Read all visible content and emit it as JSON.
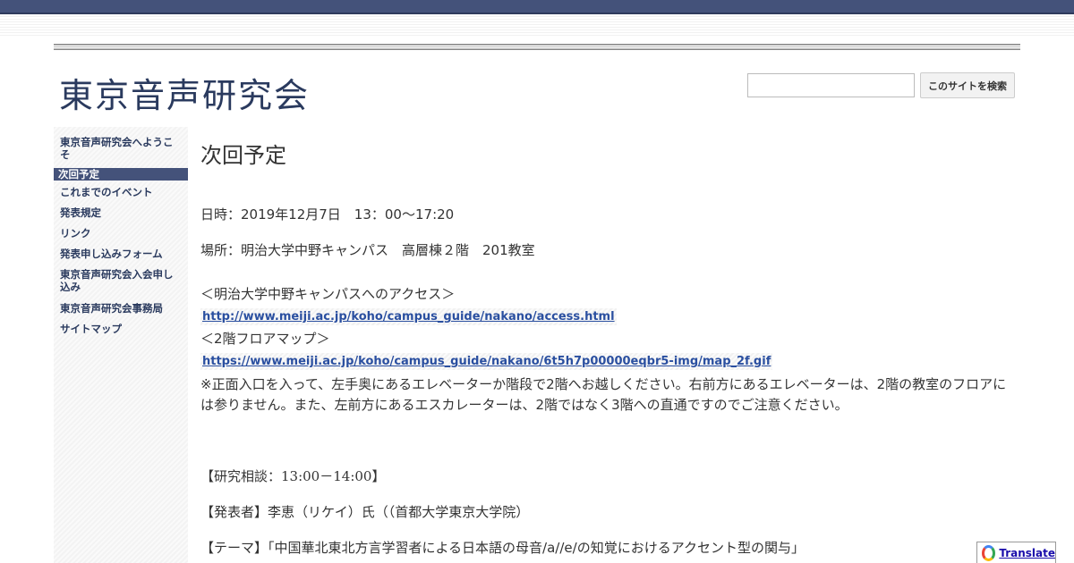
{
  "site": {
    "title": "東京音声研究会"
  },
  "search": {
    "placeholder": "",
    "button_label": "このサイトを検索"
  },
  "sidebar": {
    "items": [
      {
        "label": "東京音声研究会へようこそ",
        "active": false
      },
      {
        "label": "次回予定",
        "active": true
      },
      {
        "label": "これまでのイベント",
        "active": false
      },
      {
        "label": "発表規定",
        "active": false
      },
      {
        "label": "リンク",
        "active": false
      },
      {
        "label": "発表申し込みフォーム",
        "active": false
      },
      {
        "label": "東京音声研究会入会申し込み",
        "active": false
      },
      {
        "label": "東京音声研究会事務局",
        "active": false
      },
      {
        "label": "サイトマップ",
        "active": false
      }
    ]
  },
  "main": {
    "page_title": "次回予定",
    "date": "日時：2019年12月7日　13：00～17:20",
    "place": "場所：明治大学中野キャンパス　高層棟２階　201教室",
    "access_heading": "＜明治大学中野キャンパスへのアクセス＞",
    "access_link": "http://www.meiji.ac.jp/koho/campus_guide/nakano/access.html",
    "floor_heading": "＜2階フロアマップ＞",
    "floor_link": "https://www.meiji.ac.jp/koho/campus_guide/nakano/6t5h7p00000eqbr5-img/map_2f.gif",
    "notice": "※正面入口を入って、左手奥にあるエレベーターか階段で2階へお越しください。右前方にあるエレベーターは、2階の教室のフロアには参りません。また、左前方にあるエスカレーターは、2階ではなく3階への直通ですのでご注意ください。",
    "consult": "【研究相談：13:00－14:00】",
    "presenter": "【発表者】李恵（リケイ）氏（（首都大学東京大学院）",
    "theme": "【テーマ】「中国華北東北方言学習者による日本語の母音/a//e/の知覚におけるアクセント型の関与」"
  },
  "translate": {
    "label": "Translate"
  },
  "colors": {
    "topbar": "#44527a",
    "title": "#2a3a5e",
    "link": "#2a4fa0",
    "active_nav": "#44527a"
  }
}
